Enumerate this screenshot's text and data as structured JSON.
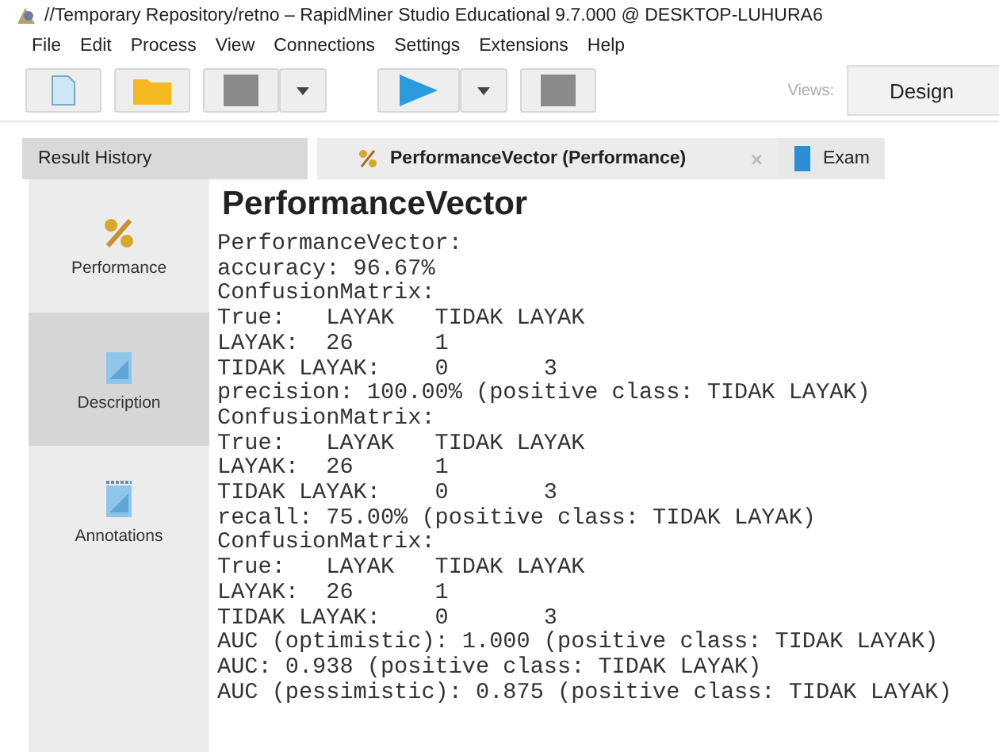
{
  "window": {
    "title": "//Temporary Repository/retno – RapidMiner Studio Educational 9.7.000 @ DESKTOP-LUHURA6"
  },
  "menu": [
    "File",
    "Edit",
    "Process",
    "View",
    "Connections",
    "Settings",
    "Extensions",
    "Help"
  ],
  "toolbar": {
    "views_label": "Views:",
    "view_button": "Design"
  },
  "tabs": [
    {
      "label": "Result History",
      "kind": "plain",
      "selected": false
    },
    {
      "label": "PerformanceVector (Performance)",
      "kind": "performance",
      "selected": true,
      "close": "×"
    },
    {
      "label": "Exam",
      "kind": "table",
      "selected": false
    }
  ],
  "sidebar": {
    "items": [
      {
        "label": "Performance",
        "kind": "percent",
        "selected": false
      },
      {
        "label": "Description",
        "kind": "document",
        "selected": true
      },
      {
        "label": "Annotations",
        "kind": "notes",
        "selected": false
      }
    ]
  },
  "content": {
    "heading": "PerformanceVector",
    "lines": [
      "PerformanceVector:",
      "accuracy: 96.67%",
      "ConfusionMatrix:",
      "True:   LAYAK   TIDAK LAYAK",
      "LAYAK:  26      1",
      "TIDAK LAYAK:    0       3",
      "precision: 100.00% (positive class: TIDAK LAYAK)",
      "ConfusionMatrix:",
      "True:   LAYAK   TIDAK LAYAK",
      "LAYAK:  26      1",
      "TIDAK LAYAK:    0       3",
      "recall: 75.00% (positive class: TIDAK LAYAK)",
      "ConfusionMatrix:",
      "True:   LAYAK   TIDAK LAYAK",
      "LAYAK:  26      1",
      "TIDAK LAYAK:    0       3",
      "AUC (optimistic): 1.000 (positive class: TIDAK LAYAK)",
      "AUC: 0.938 (positive class: TIDAK LAYAK)",
      "AUC (pessimistic): 0.875 (positive class: TIDAK LAYAK)"
    ]
  }
}
